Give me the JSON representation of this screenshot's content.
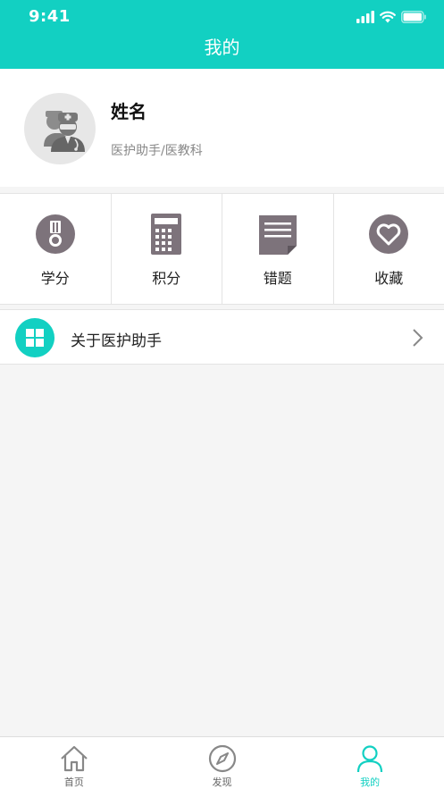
{
  "status_bar": {
    "time": "9:41"
  },
  "header": {
    "title": "我的"
  },
  "profile": {
    "name": "姓名",
    "subtitle": "医护助手/医教科"
  },
  "menu_grid": [
    {
      "label": "学分",
      "icon": "medal-icon"
    },
    {
      "label": "积分",
      "icon": "calculator-icon"
    },
    {
      "label": "错题",
      "icon": "document-icon"
    },
    {
      "label": "收藏",
      "icon": "heart-icon"
    }
  ],
  "about": {
    "label": "关于医护助手",
    "icon": "grid-icon"
  },
  "tabbar": [
    {
      "label": "首页",
      "icon": "home-icon",
      "active": false
    },
    {
      "label": "发现",
      "icon": "compass-icon",
      "active": false
    },
    {
      "label": "我的",
      "icon": "user-icon",
      "active": true
    }
  ],
  "colors": {
    "accent": "#12d0c2",
    "icon_gray": "#7d737b"
  }
}
